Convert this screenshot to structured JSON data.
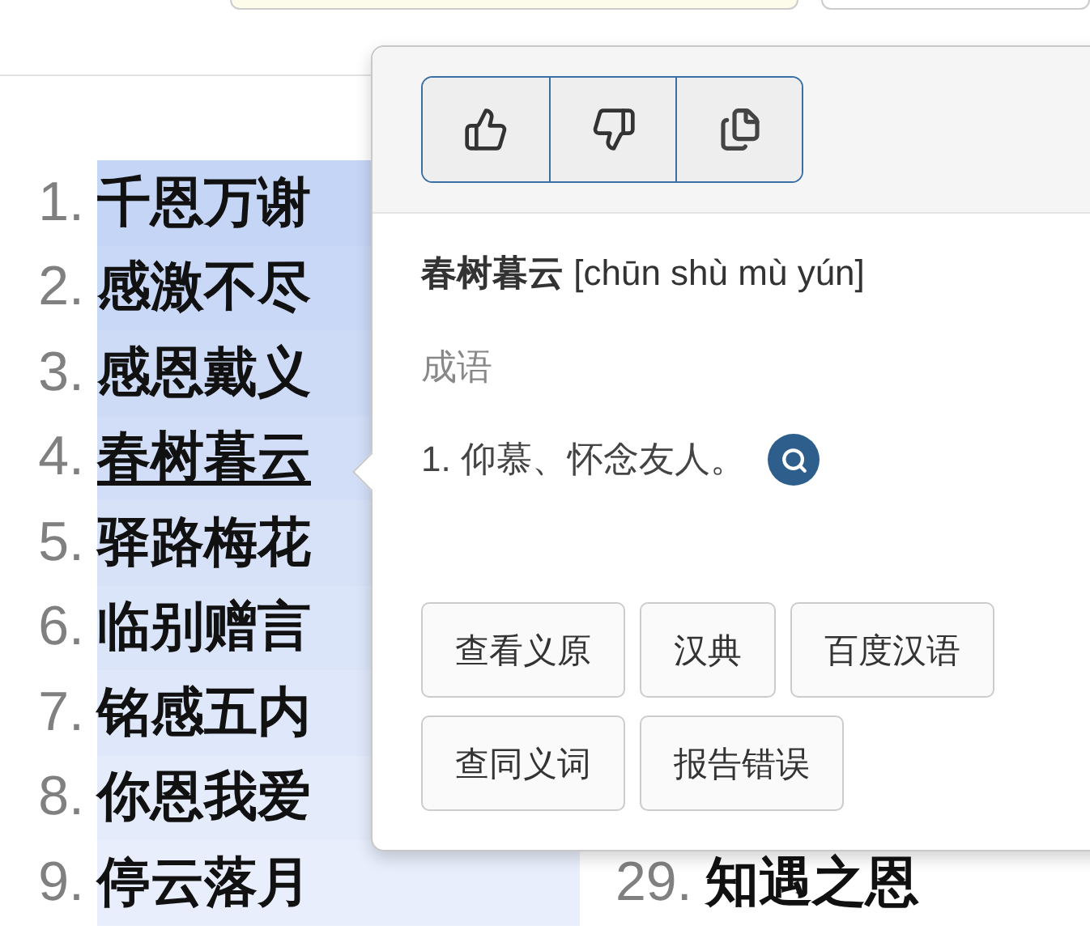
{
  "list": [
    {
      "number": "1.",
      "word": "千恩万谢",
      "highlighted": true,
      "selected": false
    },
    {
      "number": "2.",
      "word": "感激不尽",
      "highlighted": true,
      "selected": false
    },
    {
      "number": "3.",
      "word": "感恩戴义",
      "highlighted": true,
      "selected": false
    },
    {
      "number": "4.",
      "word": "春树暮云",
      "highlighted": true,
      "selected": true
    },
    {
      "number": "5.",
      "word": "驿路梅花",
      "highlighted": true,
      "selected": false
    },
    {
      "number": "6.",
      "word": "临别赠言",
      "highlighted": true,
      "selected": false
    },
    {
      "number": "7.",
      "word": "铭感五内",
      "highlighted": true,
      "selected": false
    },
    {
      "number": "8.",
      "word": "你恩我爱",
      "highlighted": true,
      "selected": false
    },
    {
      "number": "9.",
      "word": "停云落月",
      "highlighted": true,
      "selected": false
    }
  ],
  "second_column": [
    {
      "number": "29.",
      "word": "知遇之恩"
    }
  ],
  "popup": {
    "headword": "春树暮云",
    "pinyin": "[chūn shù mù yún]",
    "category": "成语",
    "definitions": [
      {
        "number": "1.",
        "text": "仰慕、怀念友人。"
      }
    ],
    "links": [
      "查看义原",
      "汉典",
      "百度汉语",
      "查同义词",
      "报告错误"
    ]
  }
}
